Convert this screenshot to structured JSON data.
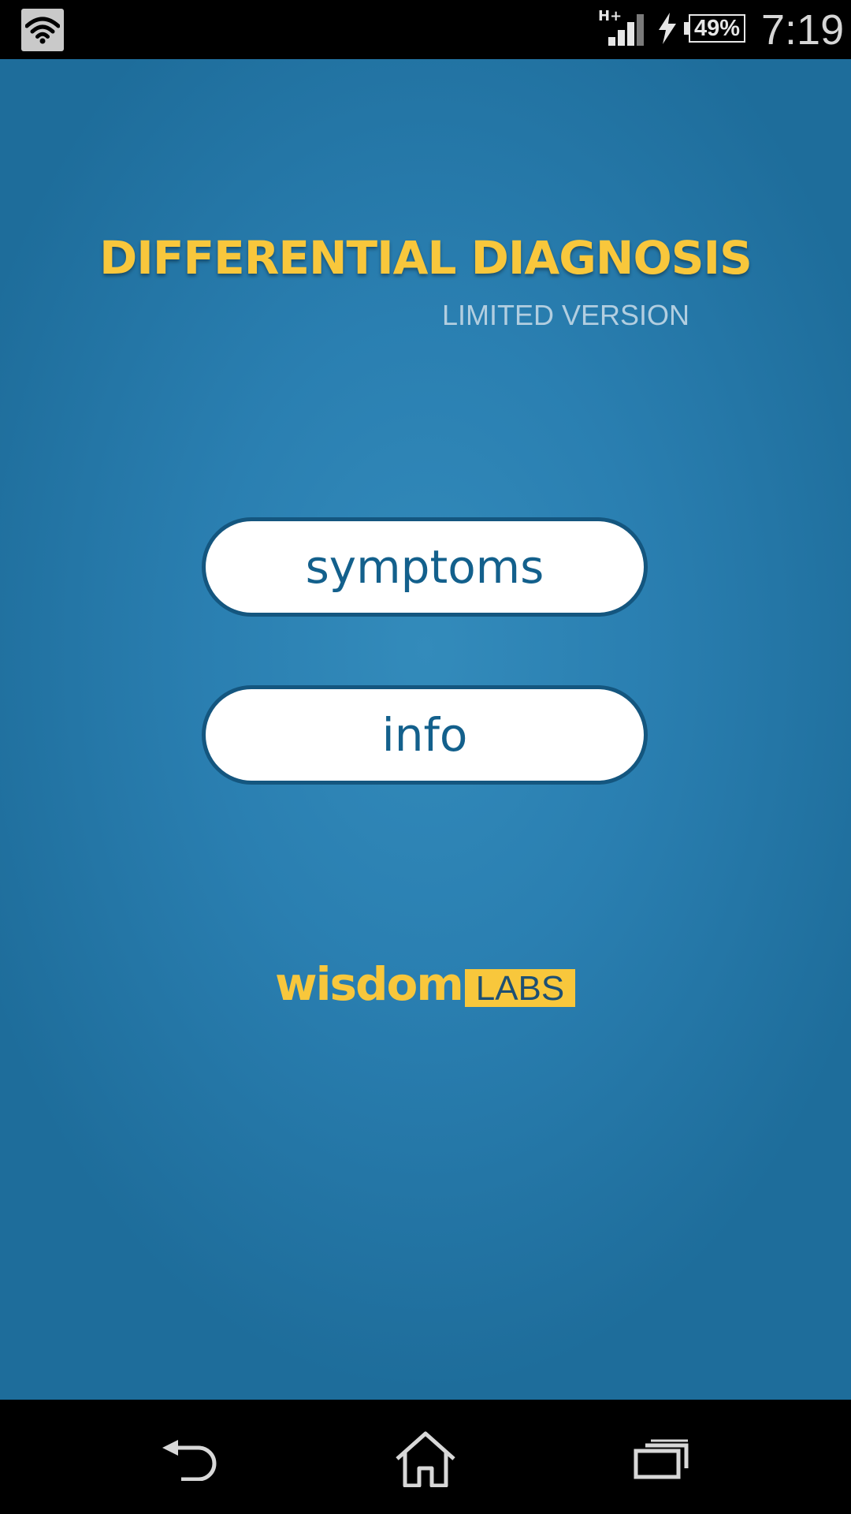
{
  "status_bar": {
    "network_type": "H+",
    "battery_level": "49%",
    "time": "7:19",
    "icons": [
      "wifi-icon",
      "signal-icon",
      "charging-icon",
      "battery-icon"
    ]
  },
  "app": {
    "title": "DIFFERENTIAL DIAGNOSIS",
    "subtitle": "LIMITED VERSION",
    "buttons": {
      "symptoms": "symptoms",
      "info": "info"
    },
    "brand": {
      "word": "wisdom",
      "tag": "LABS"
    },
    "colors": {
      "title": "#f8c73c",
      "background": "#2a7fb1",
      "button_text": "#13608c",
      "button_border": "#14567f"
    }
  },
  "nav_bar": {
    "icons": [
      "back-icon",
      "home-icon",
      "recents-icon"
    ]
  }
}
